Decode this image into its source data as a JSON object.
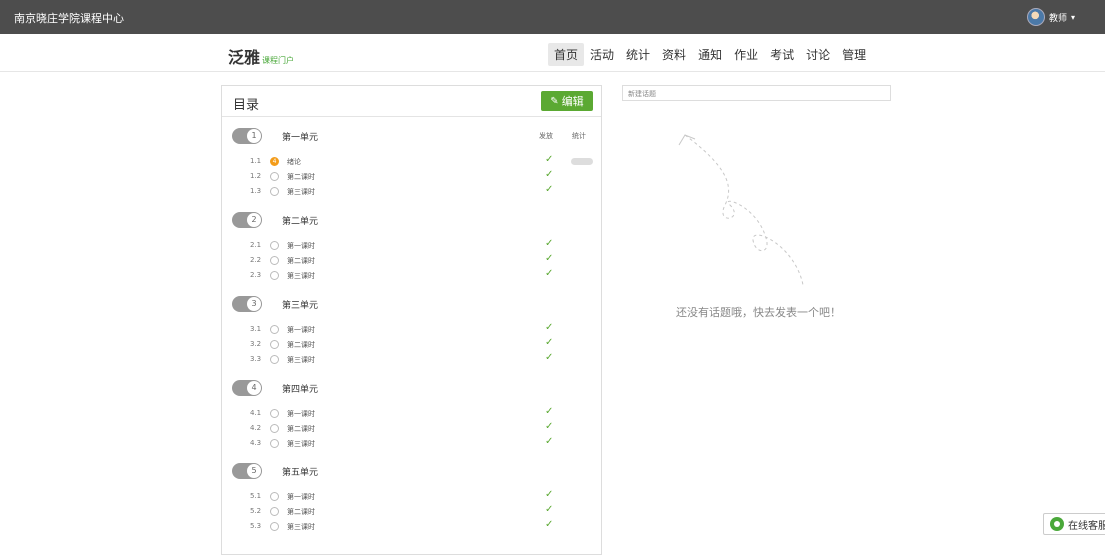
{
  "topbar": {
    "site": "南京晓庄学院课程中心",
    "user": "教师"
  },
  "brand": {
    "name": "泛雅",
    "sub": "课程门户"
  },
  "nav": [
    "首页",
    "活动",
    "统计",
    "资料",
    "通知",
    "作业",
    "考试",
    "讨论",
    "管理"
  ],
  "catalog": {
    "title": "目录",
    "edit_label": "编辑",
    "col_release": "发放",
    "col_stat": "统计",
    "units": [
      {
        "num": "1",
        "name": "第一单元",
        "lessons": [
          {
            "num": "1.1",
            "name": "绪论",
            "active": true,
            "marker": "4"
          },
          {
            "num": "1.2",
            "name": "第二课时"
          },
          {
            "num": "1.3",
            "name": "第三课时"
          }
        ]
      },
      {
        "num": "2",
        "name": "第二单元",
        "lessons": [
          {
            "num": "2.1",
            "name": "第一课时"
          },
          {
            "num": "2.2",
            "name": "第二课时"
          },
          {
            "num": "2.3",
            "name": "第三课时"
          }
        ]
      },
      {
        "num": "3",
        "name": "第三单元",
        "lessons": [
          {
            "num": "3.1",
            "name": "第一课时"
          },
          {
            "num": "3.2",
            "name": "第二课时"
          },
          {
            "num": "3.3",
            "name": "第三课时"
          }
        ]
      },
      {
        "num": "4",
        "name": "第四单元",
        "lessons": [
          {
            "num": "4.1",
            "name": "第一课时"
          },
          {
            "num": "4.2",
            "name": "第二课时"
          },
          {
            "num": "4.3",
            "name": "第三课时"
          }
        ]
      },
      {
        "num": "5",
        "name": "第五单元",
        "lessons": [
          {
            "num": "5.1",
            "name": "第一课时"
          },
          {
            "num": "5.2",
            "name": "第二课时"
          },
          {
            "num": "5.3",
            "name": "第三课时"
          }
        ]
      }
    ]
  },
  "discussion": {
    "new_topic_placeholder": "新建话题",
    "empty_text": "还没有话题哦，快去发表一个吧！"
  },
  "support": {
    "label": "在线客服"
  },
  "colors": {
    "accent_green": "#5ba932",
    "active_orange": "#f39c1a",
    "topbar": "#4d4d4d"
  }
}
